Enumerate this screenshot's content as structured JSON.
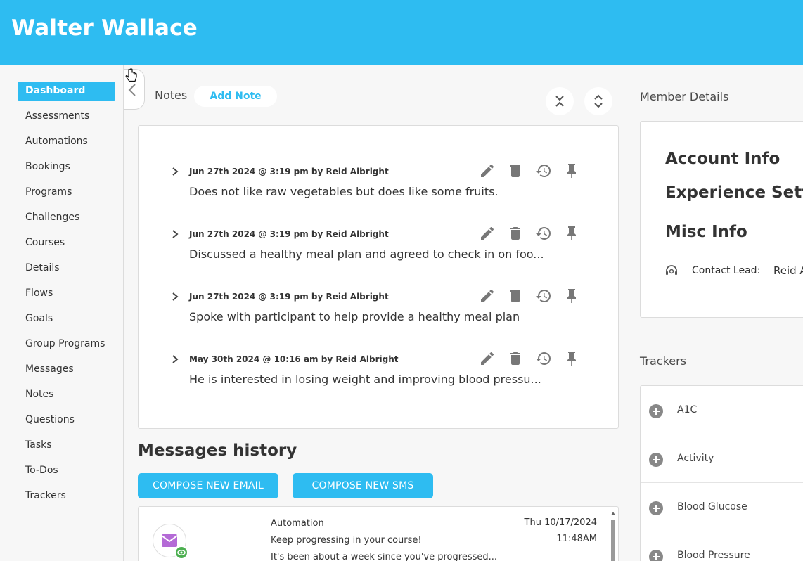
{
  "header": {
    "name": "Walter Wallace",
    "bg": "#2ebcf1"
  },
  "sidebar": {
    "items": [
      {
        "label": "Dashboard",
        "active": true
      },
      {
        "label": "Assessments"
      },
      {
        "label": "Automations"
      },
      {
        "label": "Bookings"
      },
      {
        "label": "Programs"
      },
      {
        "label": "Challenges"
      },
      {
        "label": "Courses"
      },
      {
        "label": "Details"
      },
      {
        "label": "Flows"
      },
      {
        "label": "Goals"
      },
      {
        "label": "Group Programs"
      },
      {
        "label": "Messages"
      },
      {
        "label": "Notes"
      },
      {
        "label": "Questions"
      },
      {
        "label": "Tasks"
      },
      {
        "label": "To-Dos"
      },
      {
        "label": "Trackers"
      }
    ]
  },
  "notes": {
    "title": "Notes",
    "add_label": "Add Note",
    "items": [
      {
        "meta": "Jun 27th 2024 @ 3:19 pm by Reid Albright",
        "text": "Does not like raw vegetables but does like some fruits."
      },
      {
        "meta": "Jun 27th 2024 @ 3:19 pm by Reid Albright",
        "text": "Discussed a healthy meal plan and agreed to check in on foo..."
      },
      {
        "meta": "Jun 27th 2024 @ 3:19 pm by Reid Albright",
        "text": "Spoke with participant to help provide a healthy meal plan"
      },
      {
        "meta": "May 30th 2024 @ 10:16 am by Reid Albright",
        "text": "He is interested in losing weight and improving blood pressu..."
      }
    ]
  },
  "messages": {
    "title": "Messages history",
    "compose_email": "COMPOSE NEW EMAIL",
    "compose_sms": "COMPOSE NEW SMS",
    "items": [
      {
        "source": "Automation",
        "subject": "Keep progressing in your course!",
        "preview": "It's been about a week since you've progressed...",
        "date": "Thu 10/17/2024",
        "time": "11:48AM"
      }
    ]
  },
  "member": {
    "title": "Member Details",
    "sections": [
      "Account Info",
      "Experience Setti",
      "Misc Info"
    ],
    "contact_label": "Contact Lead:",
    "contact_value": "Reid A"
  },
  "trackers": {
    "title": "Trackers",
    "items": [
      "A1C",
      "Activity",
      "Blood Glucose",
      "Blood Pressure"
    ]
  }
}
